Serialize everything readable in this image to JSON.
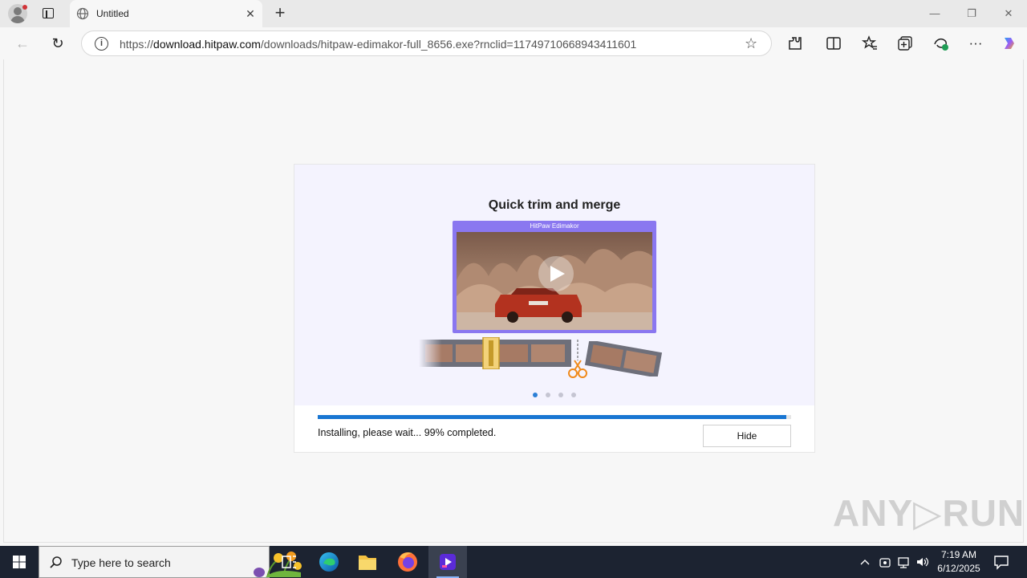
{
  "browser": {
    "tab": {
      "title": "Untitled",
      "close_glyph": "✕",
      "icon": "globe-icon"
    },
    "new_tab_glyph": "+",
    "window_controls": {
      "minimize": "—",
      "restore": "❐",
      "close": "✕"
    },
    "address_bar": {
      "url_prefix": "https://",
      "url_host": "download.hitpaw.com",
      "url_path": "/downloads/hitpaw-edimakor-full_8656.exe?rnclid=11749710668943411601"
    },
    "nav": {
      "back_glyph": "←",
      "reload_glyph": "↻"
    },
    "toolbar_icons": [
      "extensions-icon",
      "split-screen-icon",
      "favorites-icon",
      "collections-icon",
      "browser-essentials-icon",
      "more-icon",
      "copilot-icon"
    ]
  },
  "installer": {
    "slide_title": "Quick trim and merge",
    "preview_title": "HitPaw Edimakor",
    "carousel": {
      "count": 4,
      "active_index": 0
    },
    "progress": {
      "percent": 99,
      "color": "#1976d2"
    },
    "status_text": "Installing, please wait... 99% completed.",
    "hide_label": "Hide"
  },
  "watermark": {
    "text": "ANY▷RUN"
  },
  "taskbar": {
    "search_placeholder": "Type here to search",
    "apps": [
      "task-view-icon",
      "edge-icon",
      "file-explorer-icon",
      "firefox-icon",
      "edimakor-icon"
    ],
    "active_app": "edimakor-icon",
    "clock": {
      "time": "7:19 AM",
      "date": "6/12/2025"
    }
  }
}
